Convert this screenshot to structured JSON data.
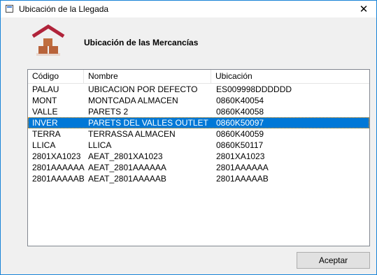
{
  "window": {
    "title": "Ubicación de la Llegada",
    "close_glyph": "✕"
  },
  "header": {
    "icon": "warehouse-boxes-icon",
    "title": "Ubicación de las Mercancías"
  },
  "list": {
    "columns": [
      "Código",
      "Nombre",
      "Ubicación"
    ],
    "rows": [
      {
        "codigo": "PALAU",
        "nombre": "UBICACION POR DEFECTO",
        "ubicacion": "ES009998DDDDDD"
      },
      {
        "codigo": "MONT",
        "nombre": "MONTCADA ALMACEN",
        "ubicacion": "0860K40054"
      },
      {
        "codigo": "VALLE",
        "nombre": "PARETS 2",
        "ubicacion": "0860K40058"
      },
      {
        "codigo": "INVER",
        "nombre": "PARETS DEL VALLES OUTLET",
        "ubicacion": "0860K50097"
      },
      {
        "codigo": "TERRA",
        "nombre": "TERRASSA ALMACEN",
        "ubicacion": "0860K40059"
      },
      {
        "codigo": "LLICA",
        "nombre": "LLICA",
        "ubicacion": "0860K50117"
      },
      {
        "codigo": "2801XA1023",
        "nombre": "AEAT_2801XA1023",
        "ubicacion": "2801XA1023"
      },
      {
        "codigo": "2801AAAAAA",
        "nombre": "AEAT_2801AAAAAA",
        "ubicacion": "2801AAAAAA"
      },
      {
        "codigo": "2801AAAAAB",
        "nombre": "AEAT_2801AAAAAB",
        "ubicacion": "2801AAAAAB"
      }
    ],
    "selected_index": 3
  },
  "footer": {
    "accept_label": "Aceptar"
  },
  "colors": {
    "selection": "#0078d7",
    "window_border": "#1883d7",
    "icon_roof": "#b0233a",
    "icon_box": "#b8633a"
  }
}
